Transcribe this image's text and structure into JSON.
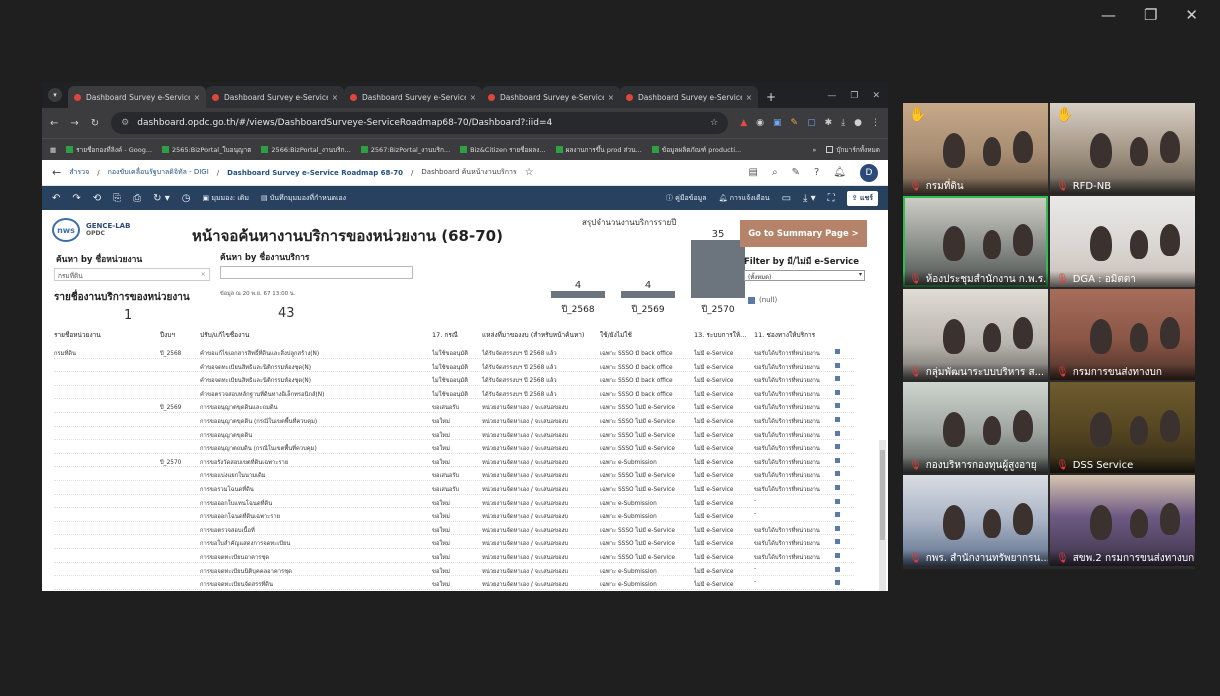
{
  "window_controls": {
    "minimize": "—",
    "restore": "❐",
    "close": "✕"
  },
  "browser": {
    "tabs": [
      {
        "title": "Dashboard Survey e-Service Roa",
        "active": true
      },
      {
        "title": "Dashboard Survey e-Service Roa"
      },
      {
        "title": "Dashboard Survey e-Service Roa"
      },
      {
        "title": "Dashboard Survey e-Service Roa"
      },
      {
        "title": "Dashboard Survey e-Service Roa"
      }
    ],
    "url": "dashboard.opdc.go.th/#/views/DashboardSurveye-ServiceRoadmap68-70/Dashboard?:iid=4",
    "bookmarks": [
      "รายชื่อกองที่ลิงค์ - Goog...",
      "2565:BizPortal_ใบอนุญาต",
      "2566:BizPortal_งานบริก...",
      "2567:BizPortal_งานบริก...",
      "Biz&Citizen รายชื่อผลง...",
      "ผลงานการขึ้น prod ส่วน...",
      "ข้อมูลผลิตภัณฑ์ producti..."
    ],
    "bookmarks_folder": "บุ๊กมาร์กทั้งหมด"
  },
  "breadcrumb": [
    "สำรวจ",
    "กองขับเคลื่อนรัฐบาลดิจิทัล - DIGI",
    "Dashboard Survey e-Service Roadmap 68-70",
    "Dashboard ค้นหน้างานบริการ"
  ],
  "user_initial": "D",
  "toolbar": {
    "view_label": "มุมมอง: เดิม",
    "subscribe_label": "บันทึกมุมมองที่กำหนดเอง",
    "guide_label": "คู่มือข้อมูล",
    "alert_label": "การแจ้งเตือน",
    "share_label": "แชร์"
  },
  "dashboard": {
    "logo_main": "nws",
    "logo_sub_top": "GENCE-LAB",
    "logo_sub_bottom": "OPDC",
    "title": "หน้าจอค้นหางานบริการของหน่วยงาน (68-70)",
    "search_org_label": "ค้นหา by ชื่อหน่วยงาน",
    "search_org_value": "กรมที่ดิน",
    "search_svc_label": "ค้นหา by ชื่องานบริการ",
    "summary_title": "สรุปจำนวนงานบริการรายปี",
    "goto_button": "Go to Summary Page >",
    "filter_label": "Filter by มี/ไม่มี e-Service",
    "filter_value": "(ทั้งหมด)",
    "legend_label": "(null)",
    "list_title": "รายชื่องานบริการของหน่วยงาน",
    "updated": "ข้อมูล ณ 20 พ.ย. 67 13:00 น.",
    "org_count": "1",
    "service_count": "43",
    "columns": [
      "รายชื่อหน่วยงาน",
      "ปีงบฯ",
      "ปรับ/แก้ไขชื่องาน",
      "17. กรณี",
      "แหล่งที่มาของงบ (สำหรับหน้าค้นหา)",
      "ใช้/ยังไม่ใช้",
      "13. ระบบการให้...",
      "11. ช่องทางให้บริการ"
    ],
    "rows": [
      [
        "กรมที่ดิน",
        "ปี_2568",
        "คำขอแก้ไขเอกสารสิทธิ์ที่ดินและสิ่งปลูกสร้าง(N)",
        "ไม่ใช้ขออนุมัติ",
        "ได้รับจัดสรรงบฯ ปี 2568 แล้ว",
        "เฉพาะ SSSO มี back office",
        "ไม่มี e-Service",
        "ขอรับได้บริการที่หน่วยงาน"
      ],
      [
        "",
        "",
        "คำขอจดทะเบียนสิทธิและนิติกรรมห้องชุด(N)",
        "ไม่ใช้ขออนุมัติ",
        "ได้รับจัดสรรงบฯ ปี 2568 แล้ว",
        "เฉพาะ SSSO มี back office",
        "ไม่มี e-Service",
        "ขอรับได้บริการที่หน่วยงาน"
      ],
      [
        "",
        "",
        "คำขอจดทะเบียนสิทธิและนิติกรรมห้องชุด(N)",
        "ไม่ใช้ขออนุมัติ",
        "ได้รับจัดสรรงบฯ ปี 2568 แล้ว",
        "เฉพาะ SSSO มี back office",
        "ไม่มี e-Service",
        "ขอรับได้บริการที่หน่วยงาน"
      ],
      [
        "",
        "",
        "คำขอตรวจสอบหลักฐานที่ดินทางอิเล็กทรอนิกส์(N)",
        "ไม่ใช้ขออนุมัติ",
        "ได้รับจัดสรรงบฯ ปี 2568 แล้ว",
        "เฉพาะ SSSO มี back office",
        "ไม่มี e-Service",
        "ขอรับได้บริการที่หน่วยงาน"
      ],
      [
        "",
        "ปี_2569",
        "การขออนุญาตขุดดินและถมดิน",
        "ขอเสนอรับ",
        "หน่วยงานจัดหาเอง / จะเสนอของบ",
        "เฉพาะ SSSO ไม่มี e-Service",
        "ไม่มี e-Service",
        "ขอรับได้บริการที่หน่วยงาน"
      ],
      [
        "",
        "",
        "การขออนุญาตขุดดิน (กรณีในเขตพื้นที่ควบคุม)",
        "ขอใหม่",
        "หน่วยงานจัดหาเอง / จะเสนอของบ",
        "เฉพาะ SSSO ไม่มี e-Service",
        "ไม่มี e-Service",
        "ขอรับได้บริการที่หน่วยงาน"
      ],
      [
        "",
        "",
        "การขออนุญาตขุดดิน",
        "ขอใหม่",
        "หน่วยงานจัดหาเอง / จะเสนอของบ",
        "เฉพาะ SSSO ไม่มี e-Service",
        "ไม่มี e-Service",
        "ขอรับได้บริการที่หน่วยงาน"
      ],
      [
        "",
        "",
        "การขออนุญาตถมดิน (กรณีในเขตพื้นที่ควบคุม)",
        "ขอใหม่",
        "หน่วยงานจัดหาเอง / จะเสนอของบ",
        "เฉพาะ SSSO ไม่มี e-Service",
        "ไม่มี e-Service",
        "ขอรับได้บริการที่หน่วยงาน"
      ],
      [
        "",
        "ปี_2570",
        "การขอรังวัดสอบเขตที่ดินเฉพาะราย",
        "ขอใหม่",
        "หน่วยงานจัดหาเอง / จะเสนอของบ",
        "เฉพาะ e-Submission",
        "ไม่มี e-Service",
        "ขอรับได้บริการที่หน่วยงาน"
      ],
      [
        "",
        "",
        "การขอแบ่งแยกในนามเดิม",
        "ขอเสนอรับ",
        "หน่วยงานจัดหาเอง / จะเสนอของบ",
        "เฉพาะ SSSO ไม่มี e-Service",
        "ไม่มี e-Service",
        "ขอรับได้บริการที่หน่วยงาน"
      ],
      [
        "",
        "",
        "การขอรวมโฉนดที่ดิน",
        "ขอเสนอรับ",
        "หน่วยงานจัดหาเอง / จะเสนอของบ",
        "เฉพาะ SSSO ไม่มี e-Service",
        "ไม่มี e-Service",
        "ขอรับได้บริการที่หน่วยงาน"
      ],
      [
        "",
        "",
        "การขอออกใบแทนโฉนดที่ดิน",
        "ขอใหม่",
        "หน่วยงานจัดหาเอง / จะเสนอของบ",
        "เฉพาะ e-Submission",
        "ไม่มี e-Service",
        "-"
      ],
      [
        "",
        "",
        "การขอออกโฉนดที่ดินเฉพาะราย",
        "ขอใหม่",
        "หน่วยงานจัดหาเอง / จะเสนอของบ",
        "เฉพาะ e-Submission",
        "ไม่มี e-Service",
        "-"
      ],
      [
        "",
        "",
        "การขอตรวจสอบเนื้อที่",
        "ขอใหม่",
        "หน่วยงานจัดหาเอง / จะเสนอของบ",
        "เฉพาะ SSSO ไม่มี e-Service",
        "ไม่มี e-Service",
        "ขอรับได้บริการที่หน่วยงาน"
      ],
      [
        "",
        "",
        "การขอใบสำคัญแสดงการจดทะเบียน",
        "ขอใหม่",
        "หน่วยงานจัดหาเอง / จะเสนอของบ",
        "เฉพาะ SSSO ไม่มี e-Service",
        "ไม่มี e-Service",
        "ขอรับได้บริการที่หน่วยงาน"
      ],
      [
        "",
        "",
        "การขอจดทะเบียนอาคารชุด",
        "ขอใหม่",
        "หน่วยงานจัดหาเอง / จะเสนอของบ",
        "เฉพาะ SSSO ไม่มี e-Service",
        "ไม่มี e-Service",
        "ขอรับได้บริการที่หน่วยงาน"
      ],
      [
        "",
        "",
        "การขอจดทะเบียนนิติบุคคลอาคารชุด",
        "ขอใหม่",
        "หน่วยงานจัดหาเอง / จะเสนอของบ",
        "เฉพาะ e-Submission",
        "ไม่มี e-Service",
        "-"
      ],
      [
        "",
        "",
        "การขอจดทะเบียนจัดสรรที่ดิน",
        "ขอใหม่",
        "หน่วยงานจัดหาเอง / จะเสนอของบ",
        "เฉพาะ e-Submission",
        "ไม่มี e-Service",
        "-"
      ],
      [
        "",
        "",
        "การขออนุญาตใช้ประโยชน์ในที่ดินของรัฐ",
        "ขอใหม่/แก้ไข",
        "หน่วยงานจัดหาเอง / จะเสนอของบ",
        "เฉพาะ e-Submission",
        "ไม่มี e-Service",
        "ขอรับได้บริการที่หน่วยงาน"
      ]
    ]
  },
  "chart_data": {
    "type": "bar",
    "title": "สรุปจำนวนงานบริการรายปี",
    "categories": [
      "ปี_2568",
      "ปี_2569",
      "ปี_2570"
    ],
    "values": [
      4,
      4,
      35
    ],
    "ylim": [
      0,
      35
    ]
  },
  "participants": [
    {
      "name": "กรมที่ดิน",
      "hand": true
    },
    {
      "name": "RFD-NB",
      "hand": true
    },
    {
      "name": "ห้องประชุมสำนักงาน ก.พ.ร.",
      "active": true
    },
    {
      "name": "DGA : อมิตตา"
    },
    {
      "name": "กลุ่มพัฒนาระบบบริหาร ส..."
    },
    {
      "name": "กรมการขนส่งทางบก"
    },
    {
      "name": "กองบริหารกองทุนผู้สูงอายุ"
    },
    {
      "name": "DSS Service"
    },
    {
      "name": "กพร. สำนักงานทรัพยากรน..."
    },
    {
      "name": "สขพ.2 กรมการขนส่งทางบก"
    }
  ]
}
